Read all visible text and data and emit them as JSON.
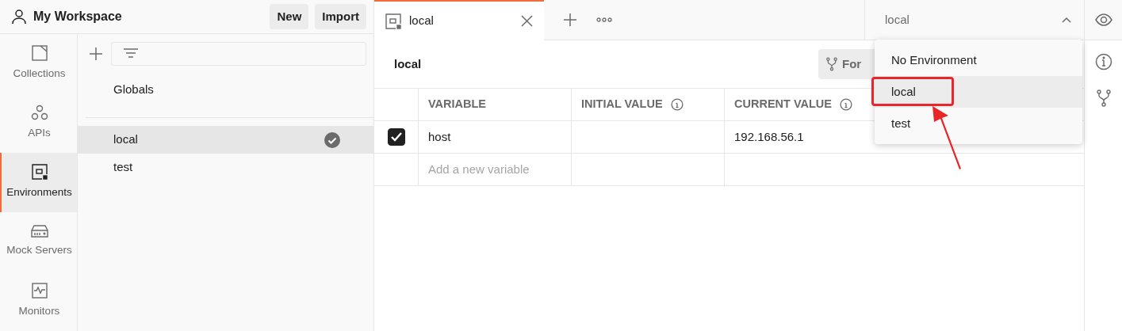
{
  "workspace": {
    "title": "My Workspace",
    "buttons": [
      "New",
      "Import"
    ]
  },
  "nav": [
    {
      "label": "Collections",
      "kind": "collections",
      "selected": false
    },
    {
      "label": "APIs",
      "kind": "apis",
      "selected": false
    },
    {
      "label": "Environments",
      "kind": "environments",
      "selected": true
    },
    {
      "label": "Mock Servers",
      "kind": "mock",
      "selected": false
    },
    {
      "label": "Monitors",
      "kind": "monitors",
      "selected": false
    }
  ],
  "globals": "Globals",
  "environments": [
    {
      "name": "local",
      "selected": true,
      "active": true
    },
    {
      "name": "test",
      "selected": false,
      "active": false
    }
  ],
  "tabs": [
    {
      "label": "local",
      "selected": true
    }
  ],
  "environment_selector": {
    "value": "local",
    "expanded": true
  },
  "environment_menu": [
    {
      "label": "No Environment",
      "highlighted": false,
      "annotated": false
    },
    {
      "label": "local",
      "highlighted": true,
      "annotated": true
    },
    {
      "label": "test",
      "highlighted": false,
      "annotated": false
    }
  ],
  "editor": {
    "title": "local",
    "fork_button": "For"
  },
  "table": {
    "columns": [
      {
        "label": "VARIABLE"
      },
      {
        "label": "INITIAL VALUE",
        "info": true
      },
      {
        "label": "CURRENT VALUE",
        "info": true
      }
    ],
    "rows": [
      {
        "checked": true,
        "variable": "host",
        "initial_value": "",
        "current_value": "192.168.56.1"
      }
    ],
    "new_row_placeholder": "Add a new variable"
  }
}
